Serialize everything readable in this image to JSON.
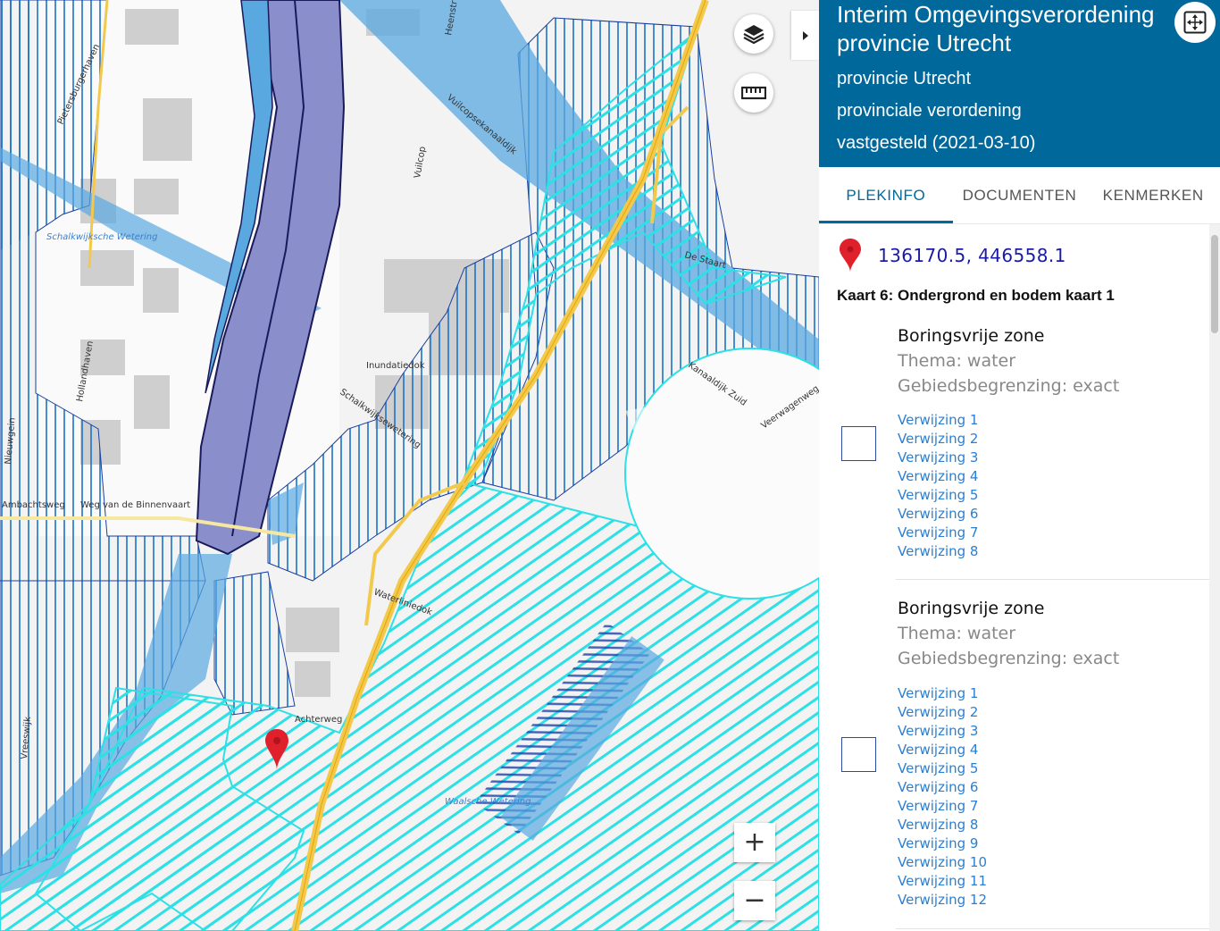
{
  "panel": {
    "title": "Interim Omgevingsverordening provincie Utrecht",
    "subtitle_1": "provincie Utrecht",
    "subtitle_2": "provinciale verordening",
    "subtitle_3": "vastgesteld (2021-03-10)",
    "tabs": [
      {
        "label": "PLEKINFO",
        "active": true
      },
      {
        "label": "DOCUMENTEN",
        "active": false
      },
      {
        "label": "KENMERKEN",
        "active": false
      }
    ],
    "coordinates": "136170.5, 446558.1",
    "section_title": "Kaart 6: Ondergrond en bodem kaart 1",
    "features": [
      {
        "name": "Boringsvrije zone",
        "thema": "Thema: water",
        "begrenzing": "Gebiedsbegrenzing: exact",
        "references": [
          "Verwijzing 1",
          "Verwijzing 2",
          "Verwijzing 3",
          "Verwijzing 4",
          "Verwijzing 5",
          "Verwijzing 6",
          "Verwijzing 7",
          "Verwijzing 8"
        ]
      },
      {
        "name": "Boringsvrije zone",
        "thema": "Thema: water",
        "begrenzing": "Gebiedsbegrenzing: exact",
        "references": [
          "Verwijzing 1",
          "Verwijzing 2",
          "Verwijzing 3",
          "Verwijzing 4",
          "Verwijzing 5",
          "Verwijzing 6",
          "Verwijzing 7",
          "Verwijzing 8",
          "Verwijzing 9",
          "Verwijzing 10",
          "Verwijzing 11",
          "Verwijzing 12"
        ]
      }
    ]
  },
  "map": {
    "controls": {
      "layers_icon": "layers-icon",
      "measure_icon": "ruler-icon",
      "zoom_in_label": "+",
      "zoom_out_label": "−",
      "collapse_icon": "caret-right-icon"
    },
    "labels": [
      "Schalkwijksche Wetering",
      "Hollandhaven",
      "Weg van de Binnenvaart",
      "Ambachtsweg",
      "Inundatiedok",
      "Schalkwijksewetering",
      "Vuilcop",
      "Vuilcopsekanaaldijk",
      "De Staart",
      "Kanaaldijk Zuid",
      "Veerwagenweg",
      "Waterliniedok",
      "Achterweg",
      "Waalsche Wetering",
      "Pietersburgerhaven",
      "Heenstr",
      "Vreeswijk",
      "Nieuwgein"
    ],
    "colors": {
      "blue_hatch": "#1a72c8",
      "cyan_hatch": "#2de0e6",
      "canal": "#8a8fcc",
      "river": "#5aa8e0",
      "road": "#f2c94c",
      "header": "#01689b"
    }
  }
}
